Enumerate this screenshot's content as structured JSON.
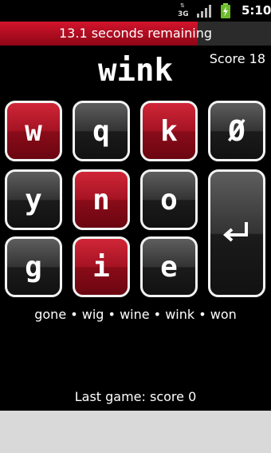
{
  "status_bar": {
    "network": "3G",
    "time": "5:10"
  },
  "timer": {
    "text": "13.1 seconds remaining",
    "fraction_remaining": 0.73
  },
  "score_text": "Score 18",
  "current_word": "wink",
  "tiles": {
    "r1c1": "w",
    "r1c2": "q",
    "r1c3": "k",
    "r1c4": "Ø",
    "r2c1": "y",
    "r2c2": "n",
    "r2c3": "o",
    "r3c1": "g",
    "r3c2": "i",
    "r3c3": "e"
  },
  "selected_tiles": [
    "r1c1",
    "r1c3",
    "r2c2",
    "r3c2"
  ],
  "enter_key_icon": "return-arrow-icon",
  "found_words": "gone • wig • wine • wink • won",
  "last_game": "Last game: score 0",
  "colors": {
    "accent_red": "#b01022",
    "tile_dark": "#2a2a2a",
    "tile_border": "#f2f2f2",
    "background": "#000000",
    "bottom_strip": "#d9d9d9"
  }
}
